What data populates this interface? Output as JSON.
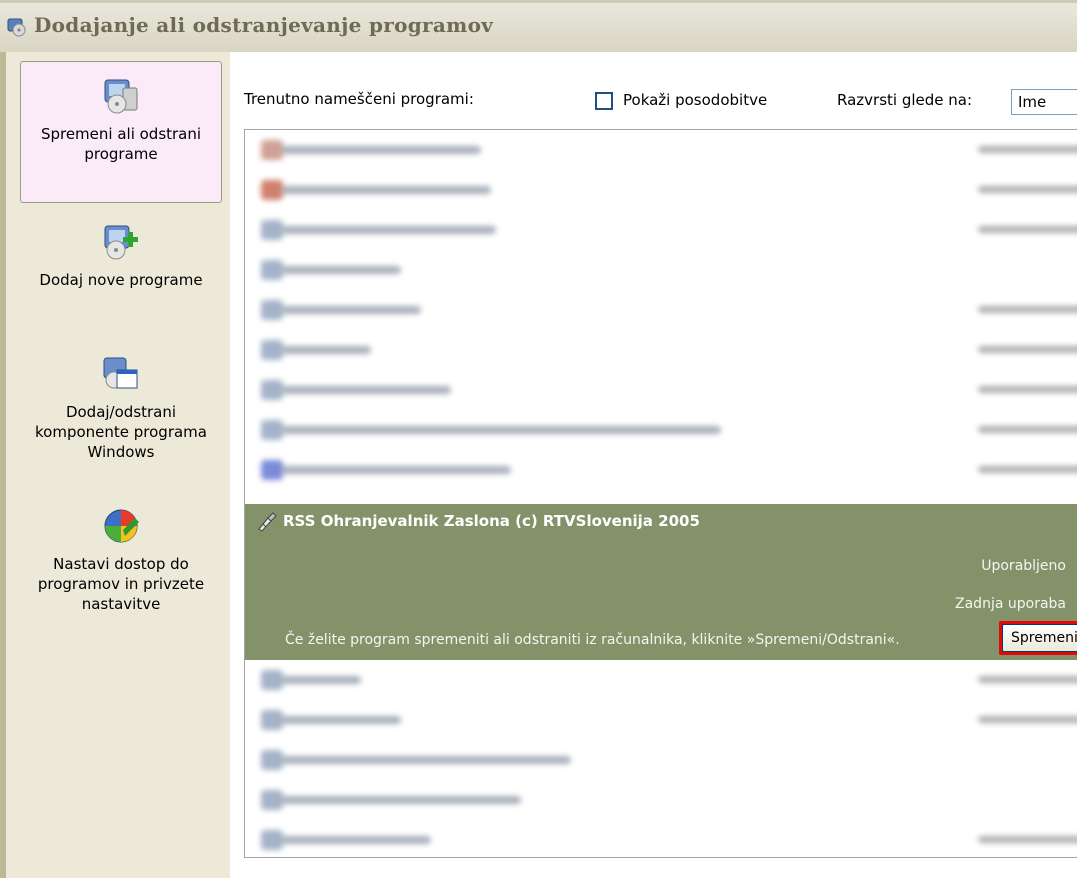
{
  "window": {
    "title": "Dodajanje ali odstranjevanje programov"
  },
  "sidebar": {
    "items": [
      {
        "label": "Spremeni ali odstrani programe",
        "icon": "change-remove-programs-icon",
        "selected": true
      },
      {
        "label": "Dodaj nove programe",
        "icon": "add-new-programs-icon",
        "selected": false
      },
      {
        "label": "Dodaj/odstrani komponente programa Windows",
        "icon": "windows-components-icon",
        "selected": false
      },
      {
        "label": "Nastavi dostop do programov in privzete nastavitve",
        "icon": "program-access-defaults-icon",
        "selected": false
      }
    ]
  },
  "main": {
    "installed_label": "Trenutno nameščeni programi:",
    "show_updates_label": "Pokaži posodobitve",
    "show_updates_checked": false,
    "sort_label": "Razvrsti glede na:",
    "sort_value": "Ime",
    "programs_blurred_count": 13,
    "selected_program": {
      "name": "RSS Ohranjevalnik Zaslona (c) RTVSlovenija 2005",
      "used_label": "Uporabljeno",
      "last_used_label": "Zadnja uporaba",
      "hint": "Če želite program spremeniti ali odstraniti iz računalnika, kliknite »Spremeni/Odstrani«.",
      "button_label": "Spremeni"
    }
  },
  "colors": {
    "sidebar_bg": "#ece9d8",
    "selected_sidebar_bg": "#fbeaf8",
    "selected_row_bg": "#84926a",
    "highlight_border": "#e00a0a",
    "title_text": "#6d6a55"
  }
}
